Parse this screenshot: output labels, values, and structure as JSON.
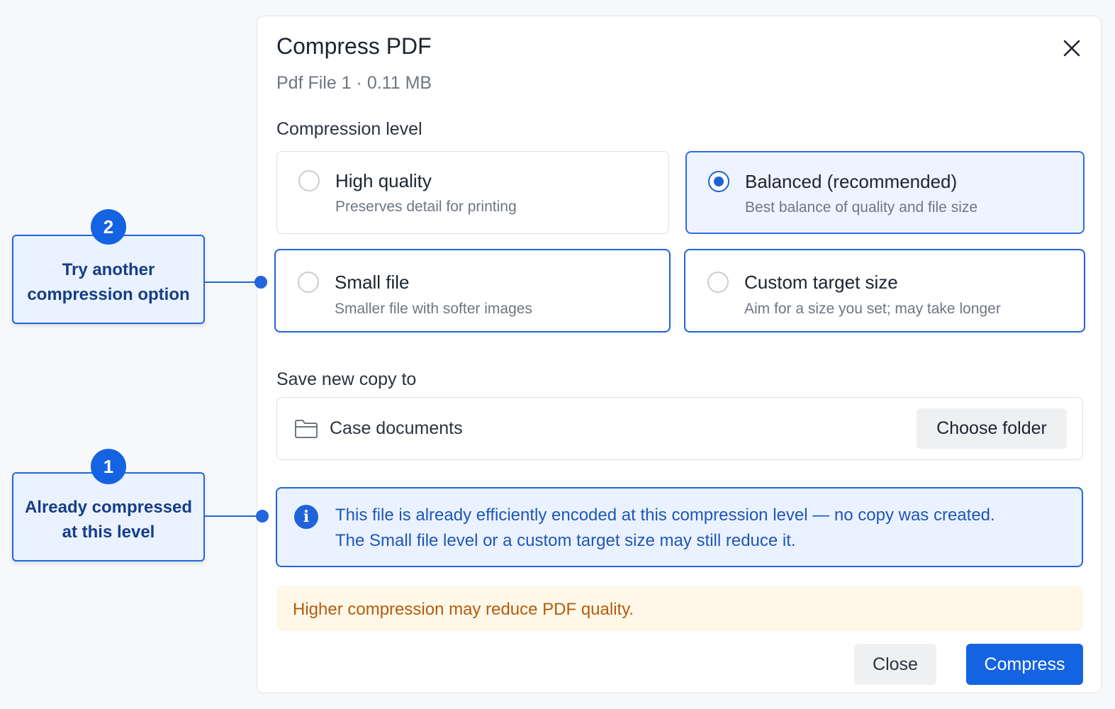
{
  "dialog": {
    "title": "Compress PDF",
    "subtitle": "Pdf File 1 · 0.11 MB",
    "close_icon": "close-icon",
    "compression_label": "Compression level",
    "options": [
      {
        "title": "High quality",
        "description": "Preserves detail for printing",
        "selected": false
      },
      {
        "title": "Balanced (recommended)",
        "description": "Best balance of quality and file size",
        "selected": true
      },
      {
        "title": "Small file",
        "description": "Smaller file with softer images",
        "selected": false
      },
      {
        "title": "Custom target size",
        "description": "Aim for a size you set; may take longer",
        "selected": false
      }
    ],
    "save_label": "Save new copy to",
    "folder": {
      "icon": "folder-icon",
      "name": "Case documents",
      "choose_label": "Choose folder"
    },
    "info": {
      "icon": "info-icon",
      "glyph": "i",
      "line1": "This file is already efficiently encoded at this compression level — no copy was created.",
      "line2": "The Small file level or a custom target size may still reduce it."
    },
    "warning": "Higher compression may reduce PDF quality.",
    "buttons": {
      "close": "Close",
      "compress": "Compress"
    }
  },
  "callouts": [
    {
      "number": "2",
      "line1": "Try another",
      "line2": "compression option"
    },
    {
      "number": "1",
      "line1": "Already compressed",
      "line2": "at this level"
    }
  ],
  "colors": {
    "accent": "#1463e3",
    "selected_bg": "#eef4ff",
    "info_text": "#1f56b8",
    "warning_bg": "#fff8e8",
    "warning_text": "#b35c0e"
  }
}
